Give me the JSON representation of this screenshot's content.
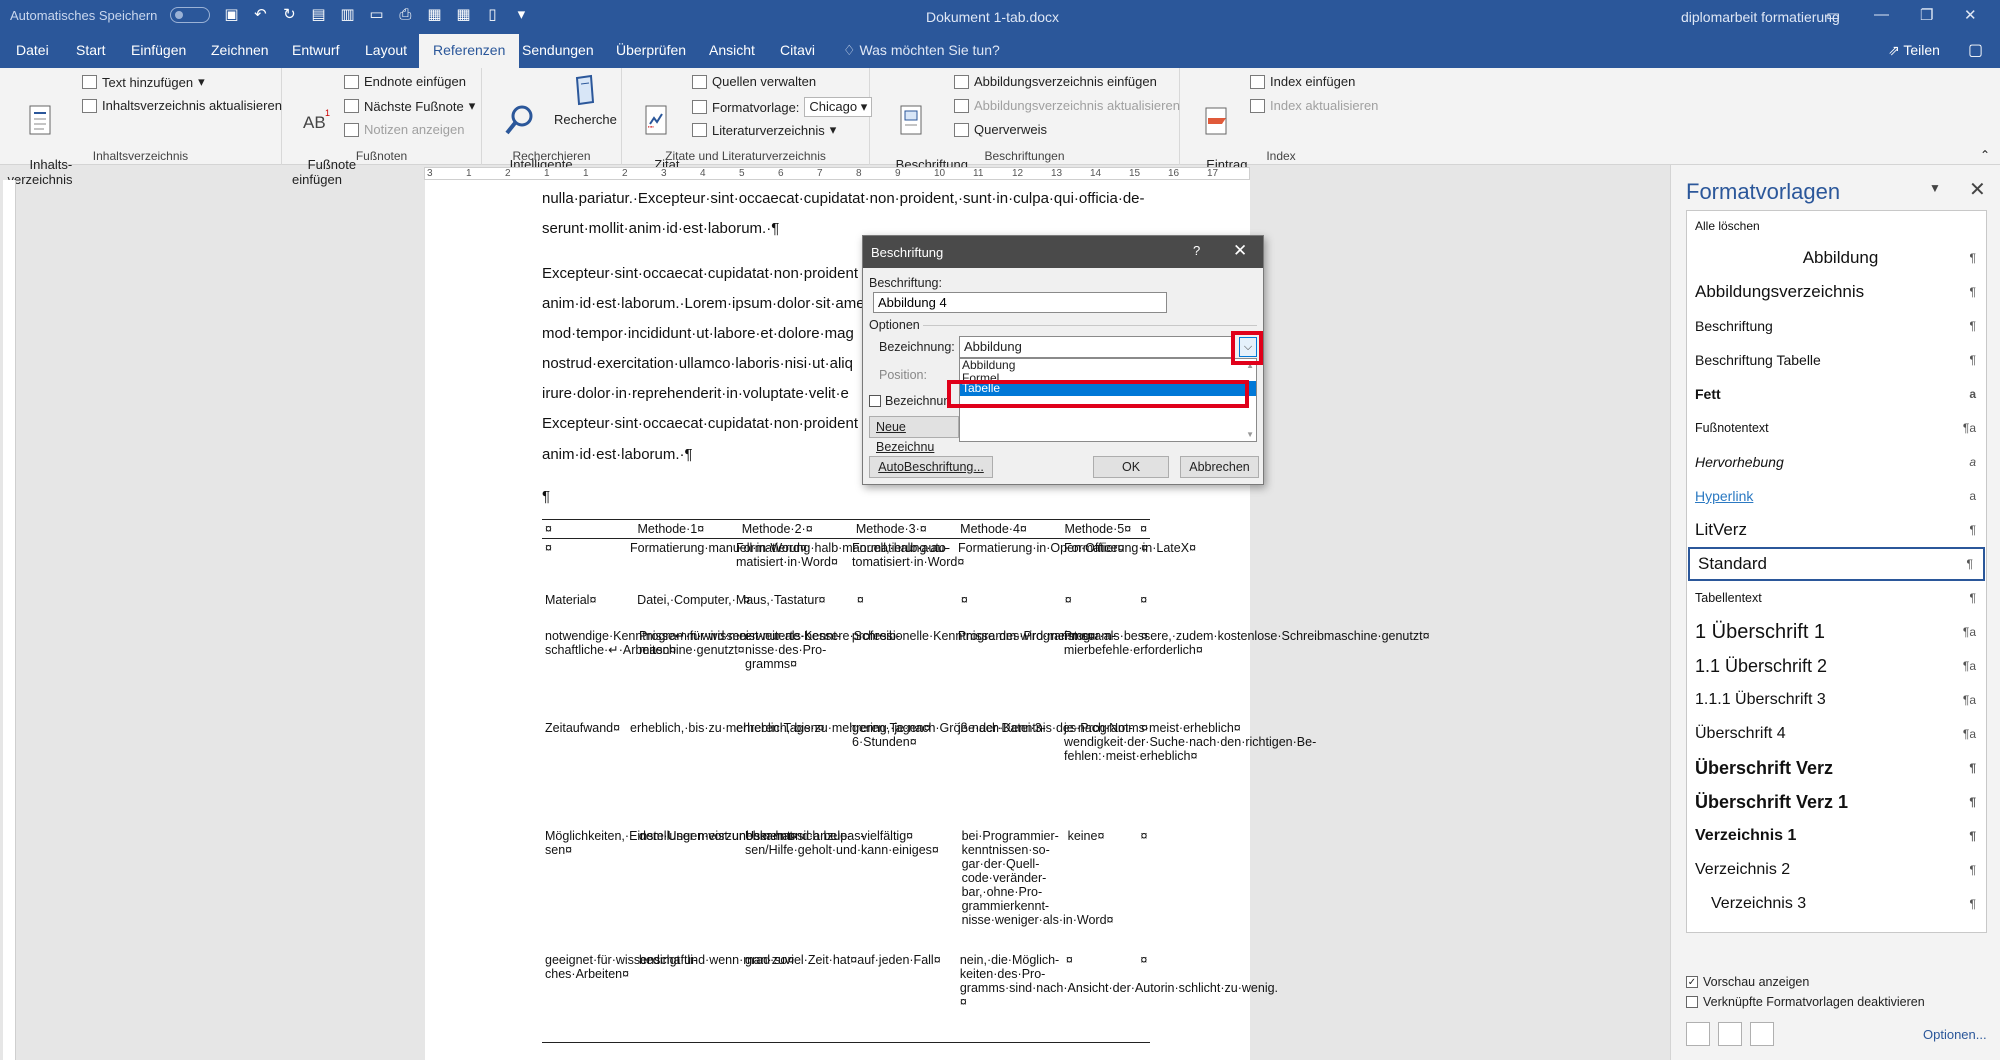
{
  "titlebar": {
    "autosave": "Automatisches Speichern",
    "doc_title": "Dokument 1-tab.docx",
    "account": "diplomarbeit formatierung"
  },
  "tabs": {
    "datei": "Datei",
    "start": "Start",
    "einfuegen": "Einfügen",
    "zeichnen": "Zeichnen",
    "entwurf": "Entwurf",
    "layout": "Layout",
    "referenzen": "Referenzen",
    "sendungen": "Sendungen",
    "ueberpruefen": "Überprüfen",
    "ansicht": "Ansicht",
    "citavi": "Citavi",
    "tellme": "Was möchten Sie tun?",
    "share": "Teilen"
  },
  "ribbon": {
    "toc": {
      "label": "Inhalts-\nverzeichnis",
      "add_text": "Text hinzufügen",
      "update": "Inhaltsverzeichnis aktualisieren",
      "group": "Inhaltsverzeichnis"
    },
    "footnotes": {
      "insert": "Fußnote\neinfügen",
      "endnote": "Endnote einfügen",
      "next": "Nächste Fußnote",
      "show": "Notizen anzeigen",
      "group": "Fußnoten"
    },
    "research": {
      "smart": "Intelligente\nSuche",
      "research": "Recherche",
      "group": "Recherchieren"
    },
    "citations": {
      "insert": "Zitat\neinfügen",
      "manage": "Quellen verwalten",
      "style_label": "Formatvorlage:",
      "style_value": "Chicago",
      "biblio": "Literaturverzeichnis",
      "group": "Zitate und Literaturverzeichnis"
    },
    "captions": {
      "insert": "Beschriftung\neinfügen",
      "tof": "Abbildungsverzeichnis einfügen",
      "tof_update": "Abbildungsverzeichnis aktualisieren",
      "crossref": "Querverweis",
      "group": "Beschriftungen"
    },
    "index": {
      "mark": "Eintrag\nmarkieren",
      "insert": "Index einfügen",
      "update": "Index aktualisieren",
      "group": "Index"
    }
  },
  "ruler": {
    "marks": [
      "3",
      "1",
      "2",
      "1",
      "1",
      "2",
      "3",
      "4",
      "5",
      "6",
      "7",
      "8",
      "9",
      "10",
      "11",
      "12",
      "13",
      "14",
      "15",
      "16",
      "17"
    ]
  },
  "document": {
    "lines": [
      "nulla·pariatur.·Excepteur·sint·occaecat·cupidatat·non·proident,·sunt·in·culpa·qui·officia·de-",
      "serunt·mollit·anim·id·est·laborum.·¶",
      "Excepteur·sint·occaecat·cupidatat·non·proident",
      "anim·id·est·laborum.·Lorem·ipsum·dolor·sit·ame",
      "mod·tempor·incididunt·ut·labore·et·dolore·mag",
      "nostrud·exercitation·ullamco·laboris·nisi·ut·aliq",
      "irure·dolor·in·reprehenderit·in·voluptate·velit·e",
      "Excepteur·sint·occaecat·cupidatat·non·proident",
      "anim·id·est·laborum.·¶",
      "¶"
    ],
    "table": {
      "header": [
        "¤",
        "Methode·1¤",
        "Methode·2·¤",
        "Methode·3·¤",
        "Methode·4¤",
        "Methode·5¤"
      ],
      "rows": [
        [
          "¤",
          "Formatierung·manuell·in·Word¤",
          "Formatierung·halb·manuell,·halb·auto-matisiert·in·Word¤",
          "Formatierung·au-tomatisiert·in·Word¤",
          "Formatierung·in·Open·Office¤",
          "Formatierung·in·LateX¤"
        ],
        [
          "Material¤",
          "Datei,·Computer,·Maus,·Tastatur¤",
          "¤",
          "¤",
          "¤",
          "¤"
        ],
        [
          "notwendige·Kenntnisse↵·für·wissen-schaftliche·↵·Arbeiten¤",
          "Programm·wird·meist·nur·als·bessere·Schreib-maschine·genutzt¤",
          "erweiterte·Kennt-nisse·des·Pro-gramms¤",
          "professionelle·Kenntnisse·des·Programms¤",
          "Programm·wird·meist·nur·als·bessere,·zudem·kostenlose·Schreibmaschine·genutzt¤",
          "Program-mierbefehle·erforderlich¤"
        ],
        [
          "Zeitaufwand¤",
          "erheblich,·bis·zu·mehreren·Tagen¤",
          "erheblich,·bis·zu·mehreren·Tagen¤",
          "gering,·je·nach·Größe·der·Datei·3-6·Stunden¤",
          "je·nach·Kenntnis·des·Programms·meist·erheblich¤",
          "je·nach·Not-wendigkeit·der·Suche·nach·den·richtigen·Be-fehlen:·meist·erheblich¤"
        ],
        [
          "Möglichkeiten,·Einstellungen·vorzunehmen·und·anzupas-sen¤",
          "dem·User·meist·unbekannt¤",
          "User·hat·sich·bele-sen/Hilfe·geholt·und·kann·einiges¤",
          "vielfältig¤",
          "bei·Programmier-kenntnissen·so-gar·der·Quell-code·veränder-bar,·ohne·Pro-grammierkennt-nisse·weniger·als·in·Word¤",
          "keine¤"
        ],
        [
          "geeignet·für·wissenschaftli-ches·Arbeiten¤",
          "bedingt·und·wenn·man·zuviel·Zeit·hat¤",
          "grad·so¤",
          "auf·jeden·Fall¤",
          "nein,·die·Möglich-keiten·des·Pro-gramms·sind·nach·Ansicht·der·Autorin·schlicht·zu·wenig.¤",
          "¤"
        ]
      ]
    }
  },
  "dialog": {
    "title": "Beschriftung",
    "help": "?",
    "close": "✕",
    "caption_label": "Beschriftung:",
    "caption_value": "Abbildung 4",
    "options_label": "Optionen",
    "label_label": "Bezeichnung:",
    "label_value": "Abbildung",
    "position_label": "Position:",
    "exclude_label": "Bezeichnun",
    "new_label_btn": "Neue Bezeichnu",
    "dropdown_options": [
      "Abbildung",
      "Formel",
      "Tabelle"
    ],
    "selected_option": "Tabelle",
    "autocaption_btn": "AutoBeschriftung...",
    "ok_btn": "OK",
    "cancel_btn": "Abbrechen"
  },
  "panel": {
    "title": "Formatvorlagen",
    "clear_all": "Alle löschen",
    "styles": [
      {
        "name": "Abbildung",
        "mark": "¶"
      },
      {
        "name": "Abbildungsverzeichnis",
        "mark": "¶"
      },
      {
        "name": "Beschriftung",
        "mark": "¶"
      },
      {
        "name": "Beschriftung Tabelle",
        "mark": "¶"
      },
      {
        "name": "Fett",
        "mark": "a"
      },
      {
        "name": "Fußnotentext",
        "mark": "¶a"
      },
      {
        "name": "Hervorhebung",
        "mark": "a"
      },
      {
        "name": "Hyperlink",
        "mark": "a"
      },
      {
        "name": "LitVerz",
        "mark": "¶"
      },
      {
        "name": "Standard",
        "mark": "¶"
      },
      {
        "name": "Tabellentext",
        "mark": "¶"
      },
      {
        "name": "1  Überschrift 1",
        "mark": "¶a"
      },
      {
        "name": "1.1  Überschrift 2",
        "mark": "¶a"
      },
      {
        "name": "1.1.1  Überschrift 3",
        "mark": "¶a"
      },
      {
        "name": "Überschrift 4",
        "mark": "¶a"
      },
      {
        "name": "Überschrift Verz",
        "mark": "¶"
      },
      {
        "name": "Überschrift Verz 1",
        "mark": "¶"
      },
      {
        "name": "Verzeichnis 1",
        "mark": "¶"
      },
      {
        "name": "Verzeichnis 2",
        "mark": "¶"
      },
      {
        "name": "Verzeichnis 3",
        "mark": "¶"
      }
    ],
    "preview_label": "Vorschau anzeigen",
    "linked_label": "Verknüpfte Formatvorlagen deaktivieren",
    "options_link": "Optionen..."
  },
  "colors": {
    "word_blue": "#2b579a",
    "highlight_red": "#e0001a",
    "selection_blue": "#0078d7"
  }
}
